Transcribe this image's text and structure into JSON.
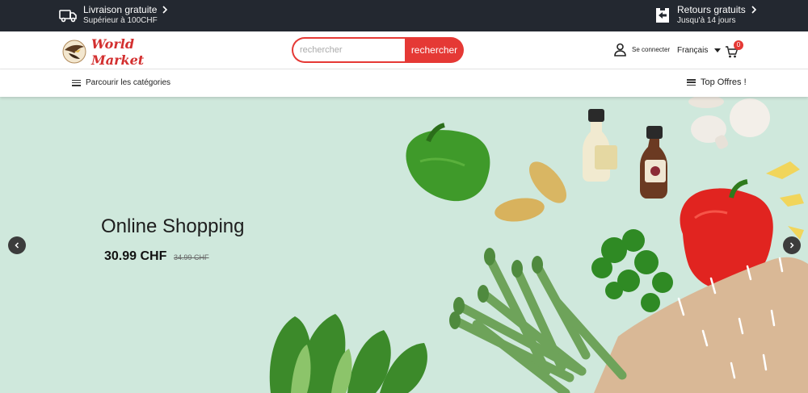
{
  "topbar": {
    "shipping_title": "Livraison gratuite",
    "shipping_sub": "Supérieur à 100CHF",
    "returns_title": "Retours gratuits",
    "returns_sub": "Jusqu'à 14 jours",
    "shipping_icon": "truck-icon",
    "returns_icon": "return-arrow-icon"
  },
  "header": {
    "logo_line1": "World",
    "logo_line2": "Market",
    "search_placeholder": "rechercher",
    "search_button": "rechercher",
    "login_label": "Se connecter",
    "language": "Français",
    "cart_count": "0"
  },
  "nav": {
    "categories_label": "Parcourir les catégories",
    "top_offers_label": "Top Offres !"
  },
  "hero": {
    "title": "Online Shopping",
    "price": "30.99 CHF",
    "old_price": "34.99 CHF"
  },
  "colors": {
    "accent": "#e53935",
    "topbar": "#232830",
    "hero_bg": "#cfe8dc"
  }
}
